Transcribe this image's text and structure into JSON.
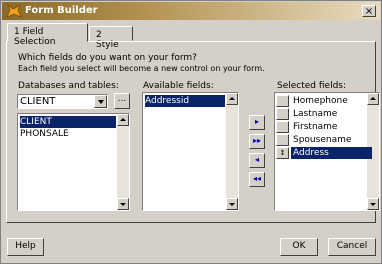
{
  "window": {
    "title": "Form Builder",
    "close_glyph": "×",
    "icon": "fox-logo-icon"
  },
  "tabs": [
    {
      "label": "1 Field Selection",
      "active": true
    },
    {
      "label": "2 Style",
      "active": false
    }
  ],
  "intro": {
    "line1": "Which fields do you want on your form?",
    "line2": "Each field you select will become a new control on your form."
  },
  "databases": {
    "label": "Databases and tables:",
    "selected": "CLIENT",
    "browse_label": "...",
    "items": [
      "CLIENT",
      "PHONSALE"
    ]
  },
  "available": {
    "label": "Available fields:",
    "items": [
      "Addressid"
    ]
  },
  "move_buttons": [
    {
      "name": "add-field-button",
      "glyph": "▸"
    },
    {
      "name": "add-all-button",
      "glyph": "▸▸"
    },
    {
      "name": "remove-field-button",
      "glyph": "◂"
    },
    {
      "name": "remove-all-button",
      "glyph": "◂◂"
    }
  ],
  "selected": {
    "label": "Selected fields:",
    "items": [
      "Homephone",
      "Lastname",
      "Firstname",
      "Spousename",
      "Address"
    ],
    "active_index": 4
  },
  "buttons": {
    "help": "Help",
    "ok": "OK",
    "cancel": "Cancel"
  },
  "colors": {
    "highlight": "#0a246a",
    "face": "#d4d0c8",
    "title_gradient_start": "#8a6a26"
  }
}
